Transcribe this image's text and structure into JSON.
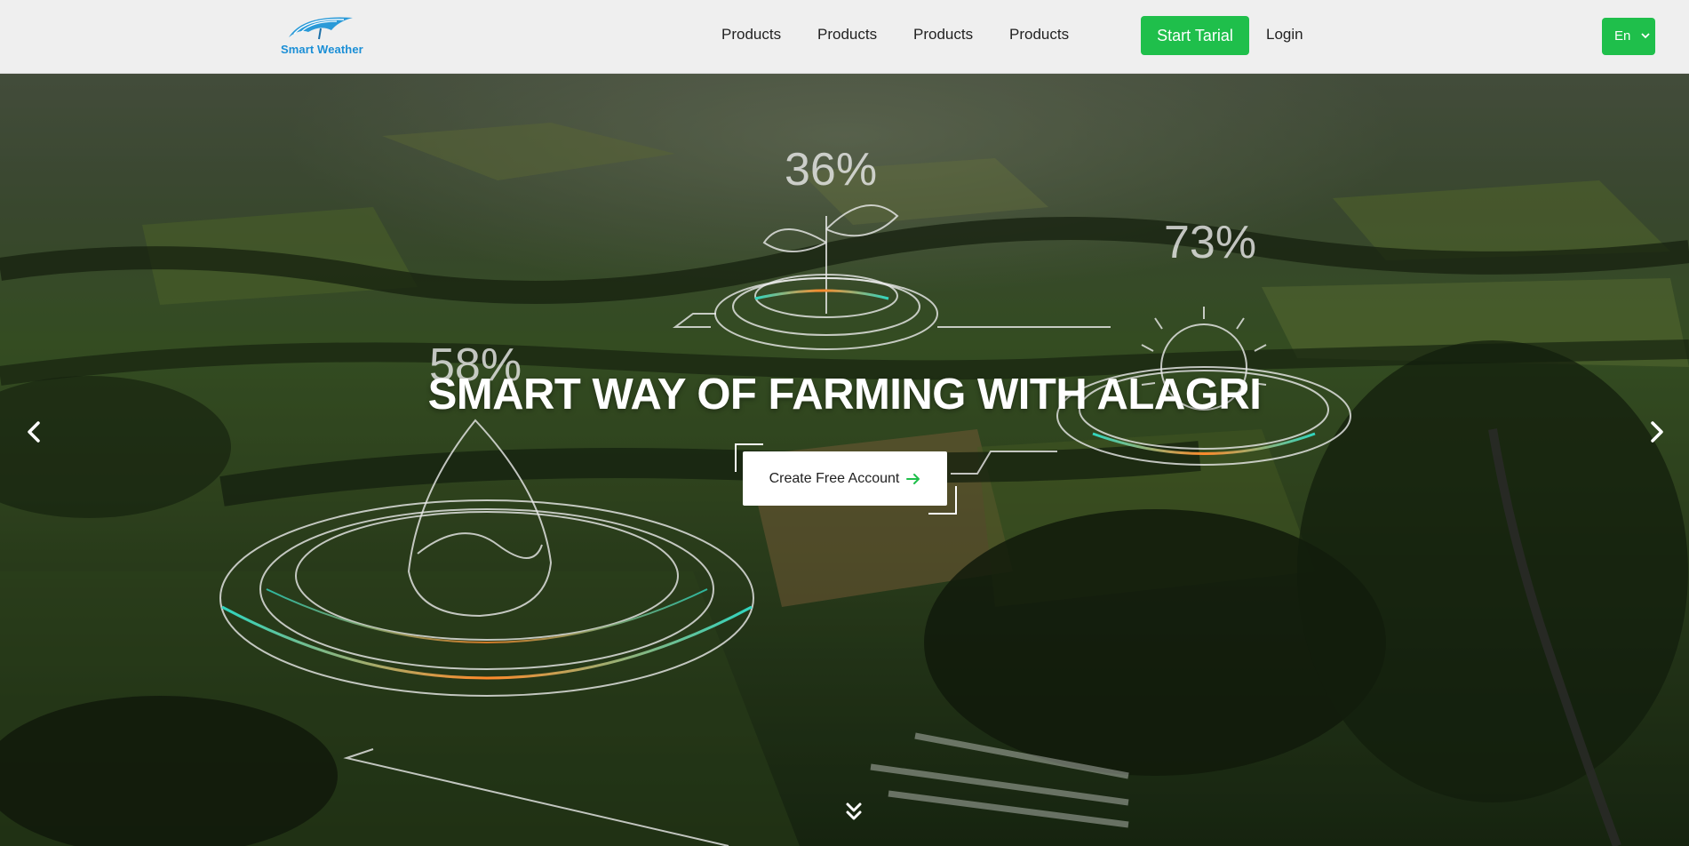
{
  "brand": {
    "name": "Smart Weather",
    "logo_icon": "umbrella-logo-icon",
    "accent_color": "#1b8fd6"
  },
  "nav": {
    "items": [
      {
        "label": "Products"
      },
      {
        "label": "Products"
      },
      {
        "label": "Products"
      },
      {
        "label": "Products"
      }
    ],
    "start_label": "Start Tarial",
    "login_label": "Login",
    "language": {
      "selected": "En",
      "icon": "chevron-down-icon"
    },
    "primary_color": "#1fbf4b"
  },
  "hero": {
    "title": "SMART WAY OF FARMING WITH ALAGRI",
    "cta_label": "Create Free Account",
    "cta_icon": "arrow-right-icon",
    "prev_icon": "chevron-left-icon",
    "next_icon": "chevron-right-icon",
    "scroll_icon": "double-chevron-down-icon",
    "stats": [
      {
        "value": "36%",
        "icon": "sprout-icon"
      },
      {
        "value": "73%",
        "icon": "sun-icon"
      },
      {
        "value": "58%",
        "icon": "water-drop-icon"
      }
    ]
  }
}
